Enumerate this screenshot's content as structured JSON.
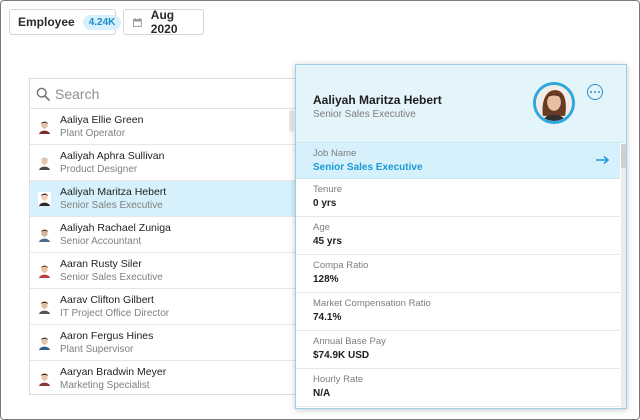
{
  "filters": {
    "employee_label": "Employee",
    "employee_count": "4.24K",
    "date_label": "Aug 2020"
  },
  "search": {
    "placeholder": "Search"
  },
  "employees": [
    {
      "name": "Aaliya Ellie Green",
      "title": "Plant Operator"
    },
    {
      "name": "Aaliyah Aphra Sullivan",
      "title": "Product Designer"
    },
    {
      "name": "Aaliyah Maritza Hebert",
      "title": "Senior Sales Executive"
    },
    {
      "name": "Aaliyah Rachael Zuniga",
      "title": "Senior Accountant"
    },
    {
      "name": "Aaran Rusty Siler",
      "title": "Senior Sales Executive"
    },
    {
      "name": "Aarav Clifton Gilbert",
      "title": "IT Project Office Director"
    },
    {
      "name": "Aaron Fergus Hines",
      "title": "Plant Supervisor"
    },
    {
      "name": "Aaryan Bradwin Meyer",
      "title": "Marketing Specialist"
    }
  ],
  "selected_index": 2,
  "detail": {
    "name": "Aaliyah Maritza Hebert",
    "title": "Senior Sales Executive",
    "fields": [
      {
        "label": "Job Name",
        "value": "Senior Sales Executive"
      },
      {
        "label": "Tenure",
        "value": "0 yrs"
      },
      {
        "label": "Age",
        "value": "45 yrs"
      },
      {
        "label": "Compa Ratio",
        "value": "128%"
      },
      {
        "label": "Market Compensation Ratio",
        "value": "74.1%"
      },
      {
        "label": "Annual Base Pay",
        "value": "$74.9K USD"
      },
      {
        "label": "Hourly Rate",
        "value": "N/A"
      }
    ]
  },
  "colors": {
    "accent": "#1a9ad6",
    "selected_bg": "#d6f1fb",
    "header_bg": "#e3f4fb"
  },
  "icons": {
    "search": "search-icon",
    "calendar": "calendar-icon",
    "more": "more-options-icon",
    "arrow": "arrow-right-icon",
    "avatar": "avatar-icon"
  }
}
